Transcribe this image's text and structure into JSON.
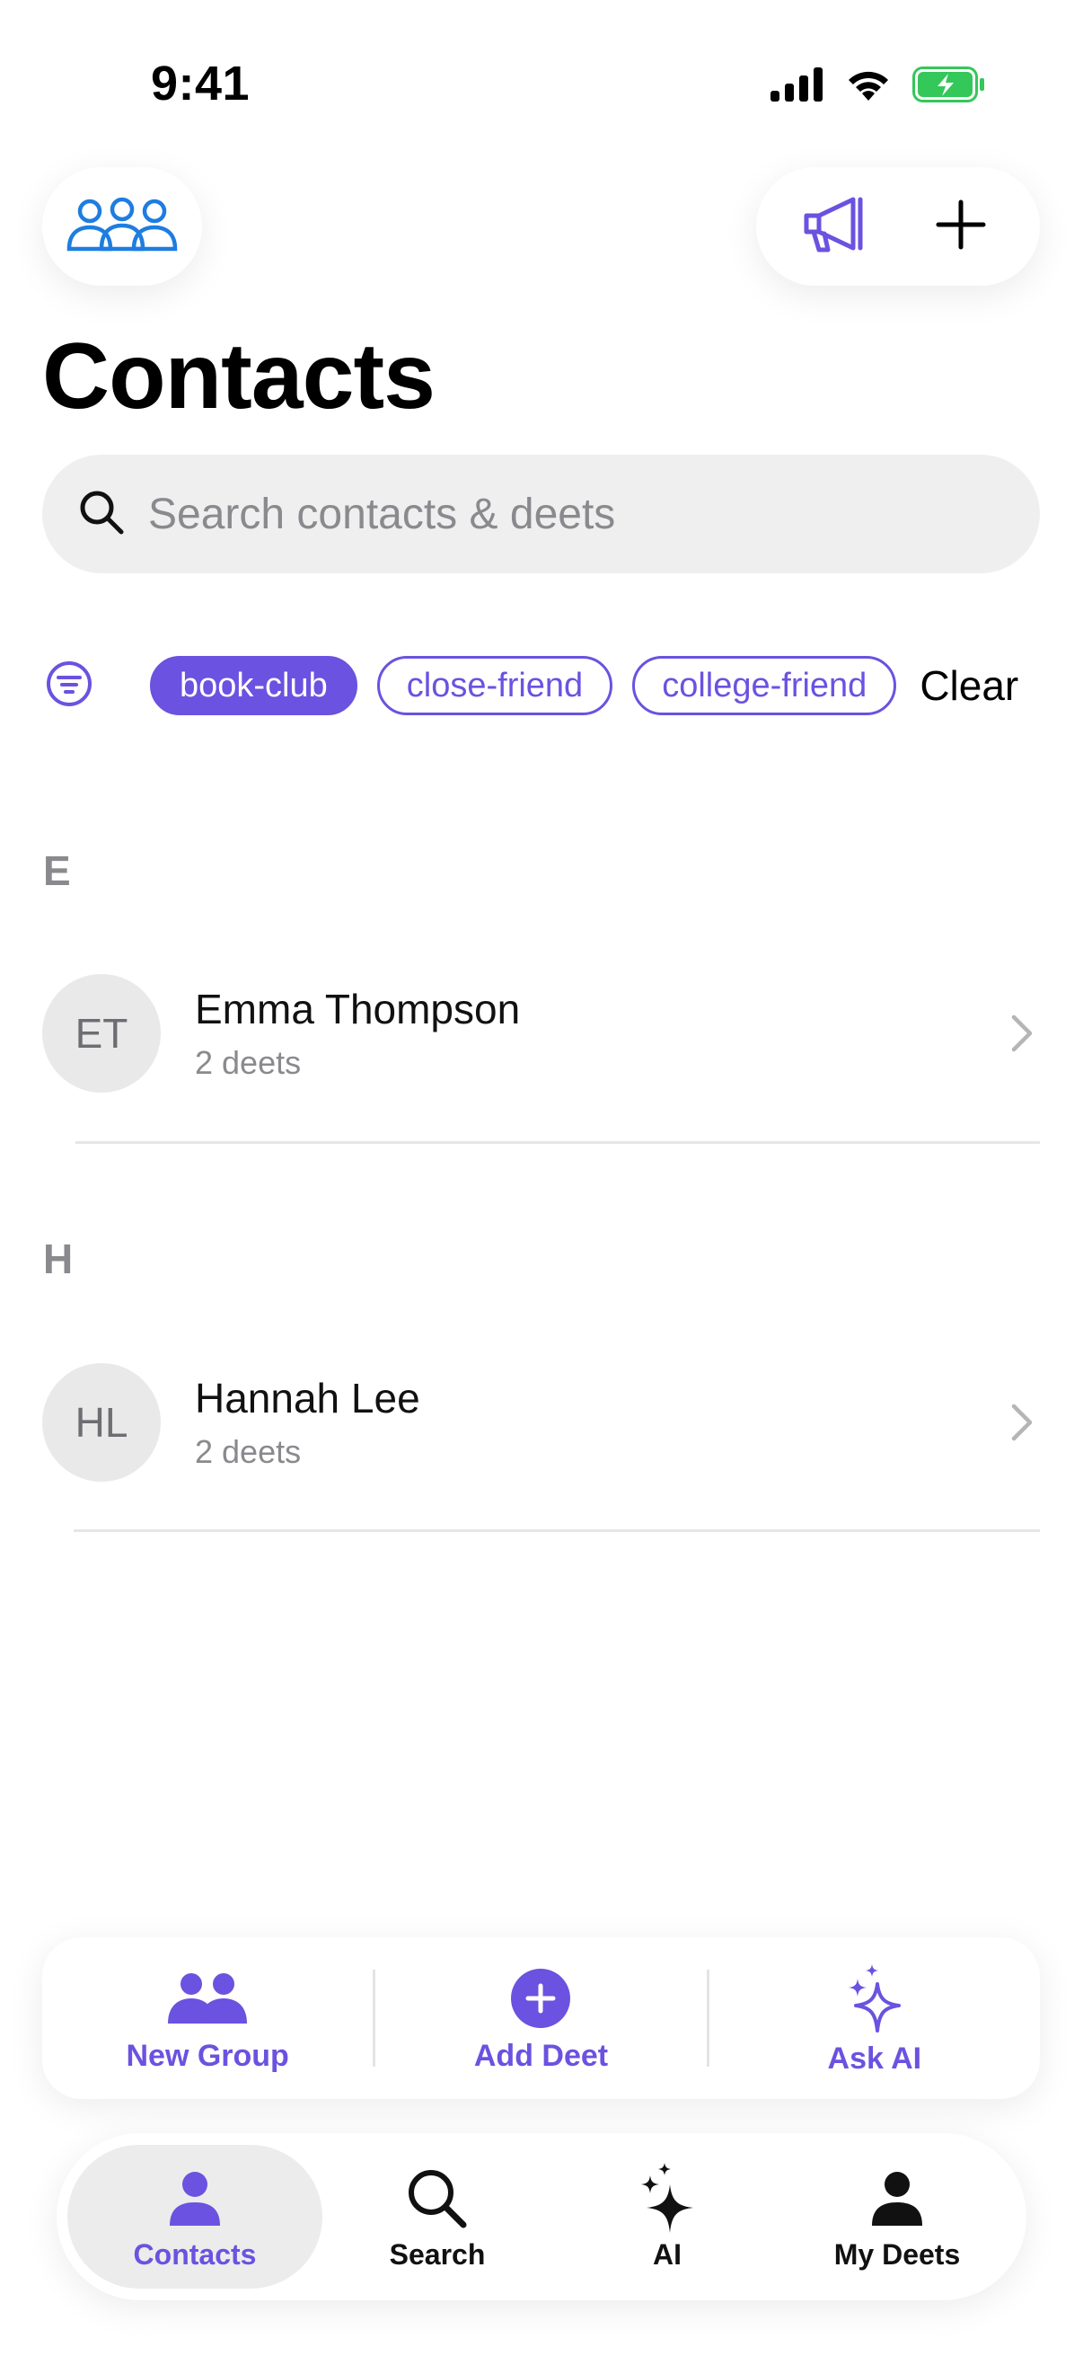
{
  "status": {
    "time": "9:41"
  },
  "header": {
    "title": "Contacts"
  },
  "search": {
    "placeholder": "Search contacts & deets",
    "value": ""
  },
  "filters": {
    "chips": [
      {
        "label": "book-club",
        "active": true
      },
      {
        "label": "close-friend",
        "active": false
      },
      {
        "label": "college-friend",
        "active": false
      }
    ],
    "clear_label": "Clear"
  },
  "sections": [
    {
      "letter": "E",
      "contacts": [
        {
          "initials": "ET",
          "name": "Emma Thompson",
          "sub": "2 deets"
        }
      ]
    },
    {
      "letter": "H",
      "contacts": [
        {
          "initials": "HL",
          "name": "Hannah Lee",
          "sub": "2 deets"
        }
      ]
    }
  ],
  "actions": [
    {
      "label": "New Group",
      "icon": "people-icon"
    },
    {
      "label": "Add Deet",
      "icon": "plus-circle-icon"
    },
    {
      "label": "Ask AI",
      "icon": "sparkles-icon"
    }
  ],
  "tabs": [
    {
      "label": "Contacts",
      "icon": "person-icon",
      "active": true
    },
    {
      "label": "Search",
      "icon": "search-icon",
      "active": false
    },
    {
      "label": "AI",
      "icon": "sparkles-icon",
      "active": false
    },
    {
      "label": "My Deets",
      "icon": "person-icon",
      "active": false
    }
  ],
  "colors": {
    "accent": "#6b52e0",
    "groups_icon": "#1e7de0",
    "battery": "#34c759"
  }
}
